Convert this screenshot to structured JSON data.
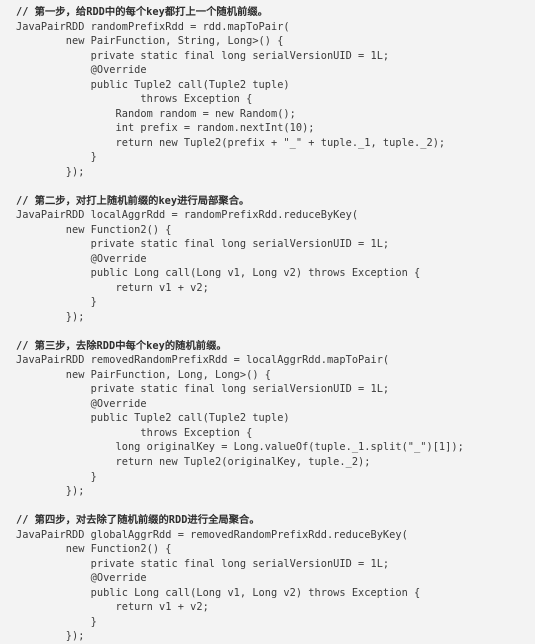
{
  "document": {
    "kind": "code-snippet",
    "language": "Java",
    "background_color": "#f3f3f3",
    "text_color": "#3a3a3a",
    "comment_color": "#2e2e2e"
  },
  "code": {
    "blocks": [
      {
        "id": "step-1",
        "comment": "// 第一步，给RDD中的每个key都打上一个随机前缀。",
        "lines": [
          "JavaPairRDD randomPrefixRdd = rdd.mapToPair(",
          "        new PairFunction, String, Long>() {",
          "            private static final long serialVersionUID = 1L;",
          "            @Override",
          "            public Tuple2 call(Tuple2 tuple)",
          "                    throws Exception {",
          "                Random random = new Random();",
          "                int prefix = random.nextInt(10);",
          "                return new Tuple2(prefix + \"_\" + tuple._1, tuple._2);",
          "            }",
          "        });"
        ]
      },
      {
        "id": "step-2",
        "comment": "// 第二步，对打上随机前缀的key进行局部聚合。",
        "lines": [
          "JavaPairRDD localAggrRdd = randomPrefixRdd.reduceByKey(",
          "        new Function2() {",
          "            private static final long serialVersionUID = 1L;",
          "            @Override",
          "            public Long call(Long v1, Long v2) throws Exception {",
          "                return v1 + v2;",
          "            }",
          "        });"
        ]
      },
      {
        "id": "step-3",
        "comment": "// 第三步，去除RDD中每个key的随机前缀。",
        "lines": [
          "JavaPairRDD removedRandomPrefixRdd = localAggrRdd.mapToPair(",
          "        new PairFunction, Long, Long>() {",
          "            private static final long serialVersionUID = 1L;",
          "            @Override",
          "            public Tuple2 call(Tuple2 tuple)",
          "                    throws Exception {",
          "                long originalKey = Long.valueOf(tuple._1.split(\"_\")[1]);",
          "                return new Tuple2(originalKey, tuple._2);",
          "            }",
          "        });"
        ]
      },
      {
        "id": "step-4",
        "comment": "// 第四步，对去除了随机前缀的RDD进行全局聚合。",
        "lines": [
          "JavaPairRDD globalAggrRdd = removedRandomPrefixRdd.reduceByKey(",
          "        new Function2() {",
          "            private static final long serialVersionUID = 1L;",
          "            @Override",
          "            public Long call(Long v1, Long v2) throws Exception {",
          "                return v1 + v2;",
          "            }",
          "        });"
        ]
      }
    ]
  }
}
